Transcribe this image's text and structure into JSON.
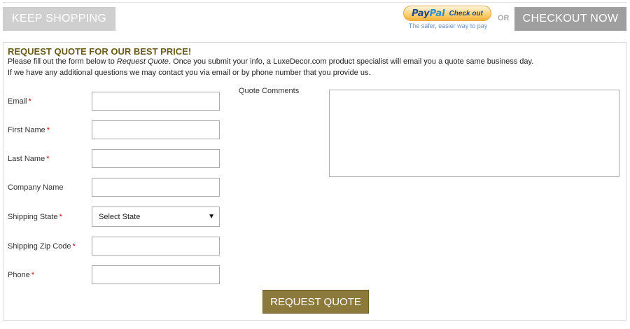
{
  "topbar": {
    "keep_shopping": "KEEP SHOPPING",
    "paypal": {
      "pay": "Pay",
      "pal": "Pal",
      "checkout": "Check out",
      "tagline": "The safer, easier way to pay"
    },
    "or_label": "OR",
    "checkout_now": "CHECKOUT NOW"
  },
  "quote": {
    "title": "REQUEST QUOTE FOR OUR BEST PRICE!",
    "intro_before": "Please fill out the form below to ",
    "intro_em": "Request Quote",
    "intro_after": ". Once you submit your info, a LuxeDecor.com product specialist will email you a quote same business day.",
    "intro_line2": "If we have any additional questions we may contact you via email or by phone number that you provide us.",
    "required_mark": "*",
    "fields": {
      "email": "Email",
      "first_name": "First Name",
      "last_name": "Last Name",
      "company": "Company Name",
      "state": "Shipping State",
      "zip": "Shipping Zip Code",
      "phone": "Phone"
    },
    "state_selected": "Select State",
    "comments_label": "Quote Comments",
    "submit": "REQUEST QUOTE"
  },
  "colors": {
    "title_gold": "#6b5a1e",
    "button_gold": "#8c7a3c",
    "required_red": "#cc0000",
    "keep_shopping_bg": "#cfcfcf",
    "checkout_bg": "#9f9f9f"
  }
}
